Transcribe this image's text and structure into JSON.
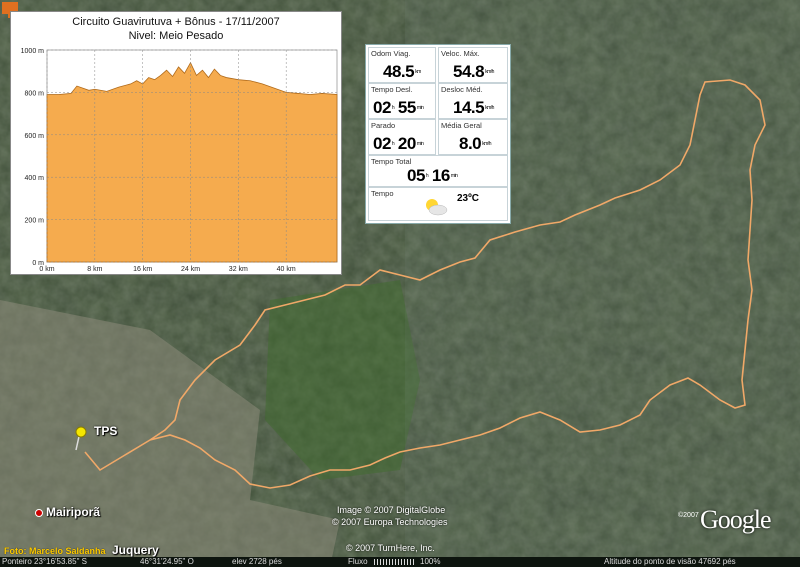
{
  "elevation_panel": {
    "title_line1": "Circuito Guavirutuva + Bônus - 17/11/2007",
    "title_line2": "Nivel: Meio Pesado",
    "y_ticks": [
      "1000 m",
      "800 m",
      "600 m",
      "400 m",
      "200 m",
      "0 m"
    ],
    "x_ticks": [
      "0 km",
      "8 km",
      "16 km",
      "24 km",
      "32 km",
      "40 km"
    ],
    "fill_color": "#f5ab4e"
  },
  "chart_data": {
    "type": "area",
    "title": "Circuito Guavirutuva + Bônus - 17/11/2007",
    "subtitle": "Nivel: Meio Pesado",
    "xlim": [
      0,
      48.5
    ],
    "ylim": [
      0,
      1000
    ],
    "x": [
      0,
      2,
      4,
      5,
      7,
      8,
      10,
      12,
      14,
      15,
      16,
      17,
      18,
      19,
      20,
      21,
      22,
      23,
      24,
      25,
      26,
      27,
      28,
      29,
      30,
      32,
      34,
      36,
      38,
      40,
      42,
      44,
      46,
      48.5
    ],
    "y": [
      790,
      790,
      795,
      830,
      810,
      815,
      805,
      825,
      840,
      855,
      840,
      870,
      860,
      880,
      905,
      875,
      920,
      890,
      940,
      880,
      905,
      870,
      910,
      880,
      870,
      860,
      855,
      840,
      820,
      800,
      795,
      790,
      795,
      790
    ]
  },
  "stats": {
    "odom": {
      "label": "Odom Viag.",
      "value": "48.5",
      "unit": "km"
    },
    "vmax": {
      "label": "Veloc. Máx.",
      "value": "54.8",
      "unit": "km/h"
    },
    "tdesl": {
      "label": "Tempo Desl.",
      "h": "02",
      "m": "55",
      "hu": "h",
      "mu": "min"
    },
    "dmed": {
      "label": "Desloc Méd.",
      "value": "14.5",
      "unit": "km/h"
    },
    "parado": {
      "label": "Parado",
      "h": "02",
      "m": "20",
      "hu": "h",
      "mu": "min"
    },
    "mgeral": {
      "label": "Média Geral",
      "value": "8.0",
      "unit": "km/h"
    },
    "ttotal": {
      "label": "Tempo Total",
      "h": "05",
      "m": "16",
      "hu": "h",
      "mu": "min"
    },
    "weather": {
      "label": "Tempo",
      "temp": "23ºC",
      "icon": "partly-cloudy-icon"
    }
  },
  "map": {
    "place_tps": "TPS",
    "place_mairipora": "Mairiporã",
    "place_juquery": "Juquery",
    "route_color": "#f0a868",
    "copyright_1": "Image © 2007 DigitalGlobe",
    "copyright_2": "© 2007 Europa Technologies",
    "copyright_3": "© 2007 TurnHere, Inc.",
    "google_year": "©2007",
    "google_logo": "Google"
  },
  "photo_credit": "Foto: Marcelo Saldanha",
  "status_bar": {
    "pointer": "Ponteiro 23°16'53.85\" S",
    "lon": "46°31'24.95\" O",
    "elev": "elev  2728 pés",
    "stream_label": "Fluxo",
    "stream_pct": "100%",
    "altitude": "Altitude do ponto de visão     47692 pés"
  }
}
